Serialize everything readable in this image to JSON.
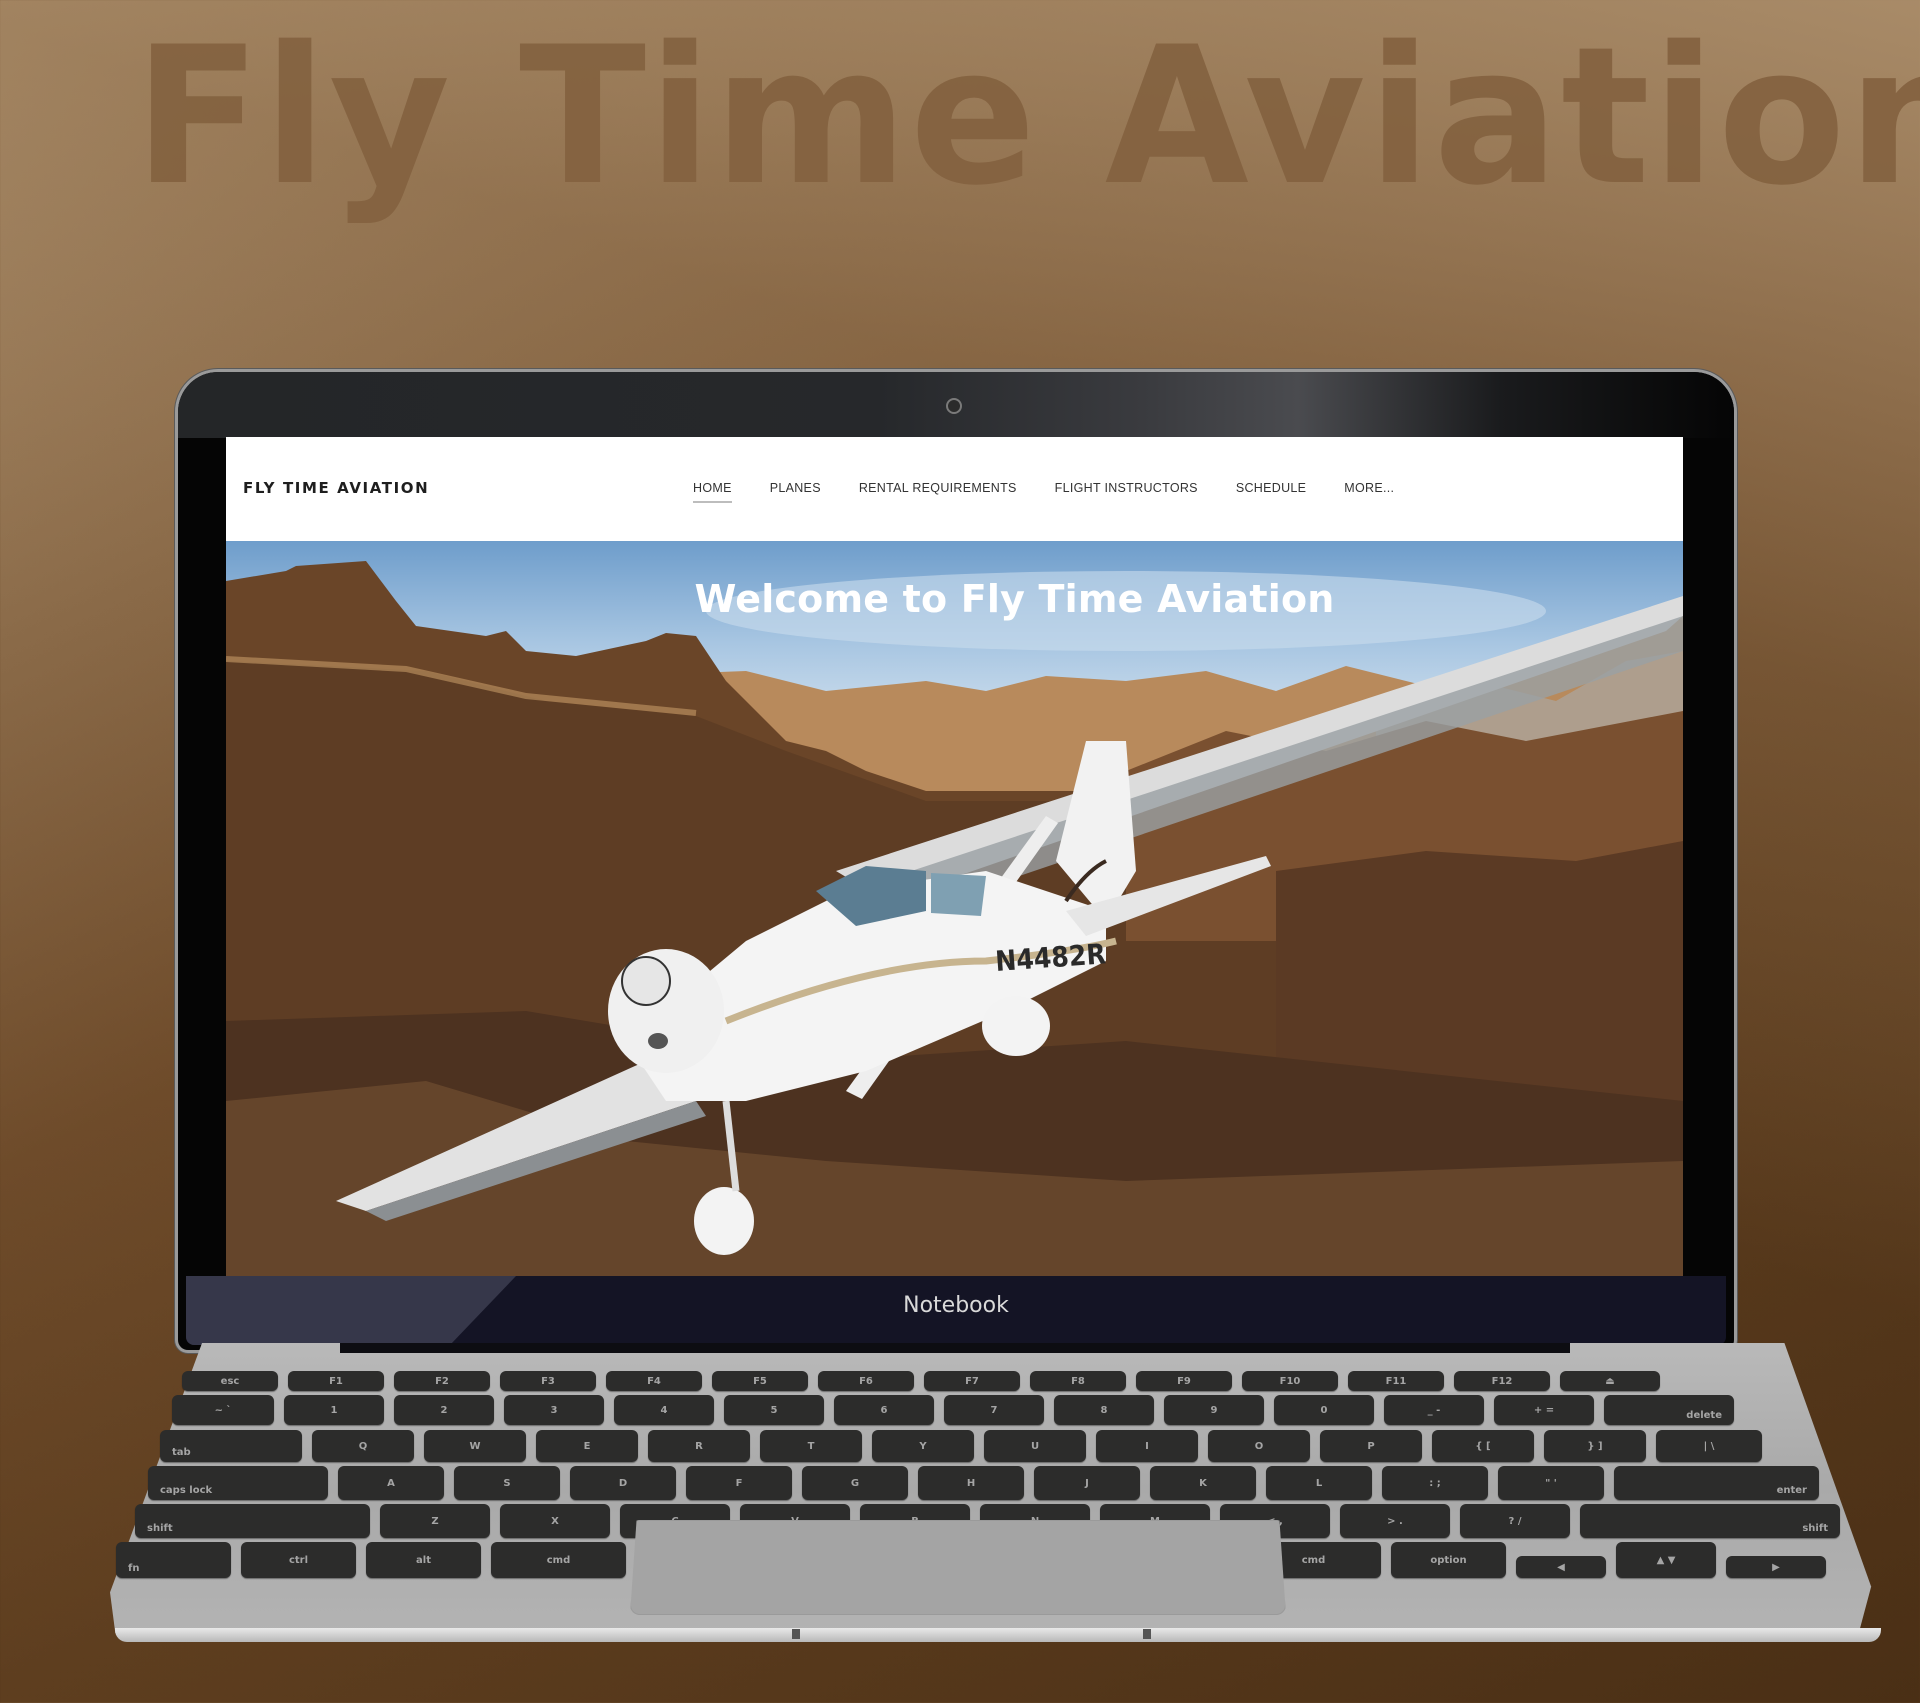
{
  "background": {
    "watermark_title": "Fly Time Aviation",
    "colors": {
      "gradient_dark": "#5c3c1e",
      "gradient_light": "#b09370",
      "watermark": "#846240"
    }
  },
  "device": {
    "chin_label": "Notebook"
  },
  "website": {
    "logo": "FLY TIME AVIATION",
    "nav": [
      {
        "label": "HOME",
        "active": true
      },
      {
        "label": "PLANES",
        "active": false
      },
      {
        "label": "RENTAL REQUIREMENTS",
        "active": false
      },
      {
        "label": "FLIGHT INSTRUCTORS",
        "active": false
      },
      {
        "label": "SCHEDULE",
        "active": false
      },
      {
        "label": "MORE...",
        "active": false
      }
    ],
    "hero": {
      "title": "Welcome to Fly Time Aviation",
      "aircraft_registration": "N4482R"
    }
  },
  "keyboard": {
    "rows": [
      [
        "esc",
        "F1",
        "F2",
        "F3",
        "F4",
        "F5",
        "F6",
        "F7",
        "F8",
        "F9",
        "F10",
        "F11",
        "F12",
        "⏏"
      ],
      [
        "~ `",
        "1",
        "2",
        "3",
        "4",
        "5",
        "6",
        "7",
        "8",
        "9",
        "0",
        "_ -",
        "+ =",
        "delete"
      ],
      [
        "tab",
        "Q",
        "W",
        "E",
        "R",
        "T",
        "Y",
        "U",
        "I",
        "O",
        "P",
        "{ [",
        "} ]",
        "| \\"
      ],
      [
        "caps lock",
        "A",
        "S",
        "D",
        "F",
        "G",
        "H",
        "J",
        "K",
        "L",
        ": ;",
        "\" '",
        "enter"
      ],
      [
        "shift",
        "Z",
        "X",
        "C",
        "V",
        "B",
        "N",
        "M",
        "< ,",
        "> .",
        "? /",
        "shift"
      ],
      [
        "fn",
        "ctrl",
        "alt",
        "cmd",
        "",
        "cmd",
        "option",
        "◀",
        "▲ ▼",
        "▶"
      ]
    ]
  }
}
